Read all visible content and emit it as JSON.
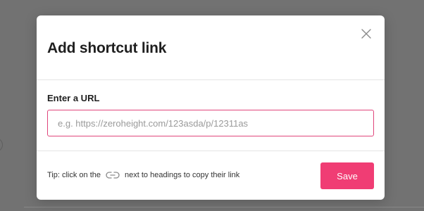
{
  "modal": {
    "title": "Add shortcut link",
    "close_icon": "close-icon",
    "url_field": {
      "label": "Enter a URL",
      "value": "",
      "placeholder": "e.g. https://zeroheight.com/123asda/p/12311as"
    },
    "tip": {
      "before_icon": "Tip: click on the",
      "icon": "link-icon",
      "after_icon": "next to headings to copy their link"
    },
    "save_label": "Save"
  },
  "colors": {
    "overlay": "#727272",
    "accent": "#f03d74",
    "input_border": "#e0457b"
  }
}
